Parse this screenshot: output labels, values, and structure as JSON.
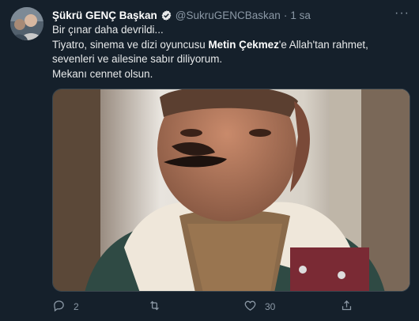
{
  "author": {
    "name": "Şükrü GENÇ Başkan",
    "handle": "@SukruGENCBaskan",
    "separator": "·",
    "time": "1 sa"
  },
  "tweet": {
    "line1": "Bir çınar daha devrildi...",
    "line2_pre": "Tiyatro, sinema ve dizi oyuncusu ",
    "line2_bold": "Metin Çekmez",
    "line2_post": "'e Allah'tan rahmet,",
    "line3": "sevenleri ve ailesine sabır diliyorum.",
    "line4": "Mekanı cennet olsun."
  },
  "icons": {
    "verified": "verified-badge-icon",
    "more": "more-icon",
    "reply": "reply-icon",
    "retweet": "retweet-icon",
    "like": "like-icon",
    "share": "share-icon"
  },
  "stats": {
    "replies": "2",
    "retweets": "",
    "likes": "30"
  },
  "colors": {
    "background": "#15202b",
    "accent": "#1d9bf0",
    "muted": "#8b98a5"
  }
}
